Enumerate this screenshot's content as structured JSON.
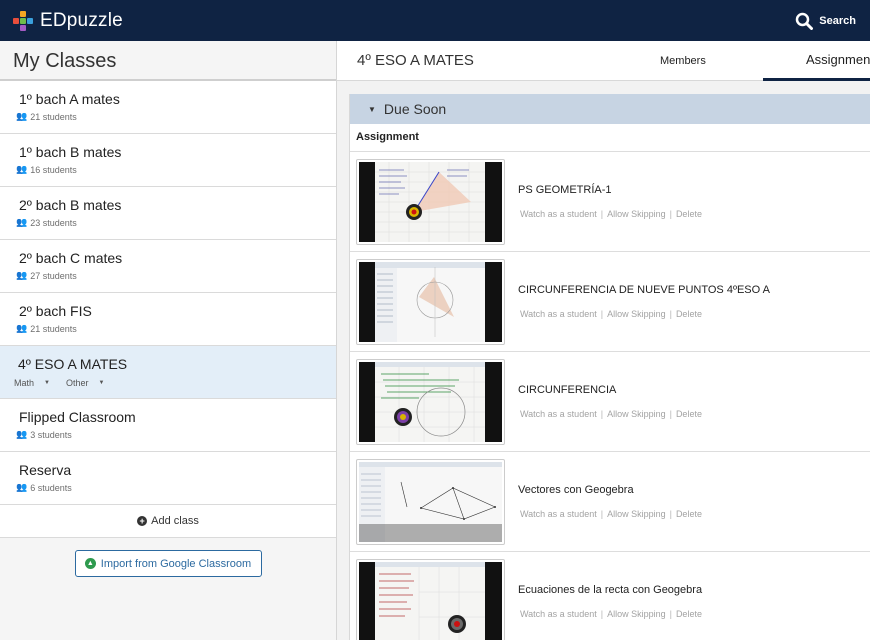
{
  "app": {
    "brand": "EDpuzzle",
    "search_label": "Search"
  },
  "sidebar": {
    "title": "My Classes",
    "classes": [
      {
        "name": "1º bach A mates",
        "students": "21 students"
      },
      {
        "name": "1º bach B mates",
        "students": "16 students"
      },
      {
        "name": "2º bach B mates",
        "students": "23 students"
      },
      {
        "name": "2º bach C mates",
        "students": "27 students"
      },
      {
        "name": "2º bach FIS",
        "students": "21 students"
      },
      {
        "name": "4º ESO A MATES",
        "tag_subject": "Math",
        "tag_grade": "Other"
      },
      {
        "name": "Flipped Classroom",
        "students": "3 students"
      },
      {
        "name": "Reserva",
        "students": "6 students"
      }
    ],
    "add_class": "Add class",
    "import_label": "Import from Google Classroom"
  },
  "main": {
    "class_title": "4º ESO A MATES",
    "tabs": {
      "members": "Members",
      "assignments": "Assignments"
    },
    "section": "Due Soon",
    "column_header": "Assignment",
    "actions": {
      "watch": "Watch as a student",
      "skip": "Allow Skipping",
      "delete": "Delete",
      "separator": "|"
    },
    "assignments": [
      {
        "title": "PS GEOMETRÍA-1"
      },
      {
        "title": "CIRCUNFERENCIA DE NUEVE PUNTOS 4ºESO A"
      },
      {
        "title": "CIRCUNFERENCIA"
      },
      {
        "title": "Vectores con Geogebra"
      },
      {
        "title": "Ecuaciones de la recta con Geogebra"
      }
    ]
  },
  "colors": {
    "topbar": "#0f2343",
    "section_head": "#c7d4e3",
    "active_class": "#e3eef8",
    "import_border": "#2c6aa0"
  }
}
